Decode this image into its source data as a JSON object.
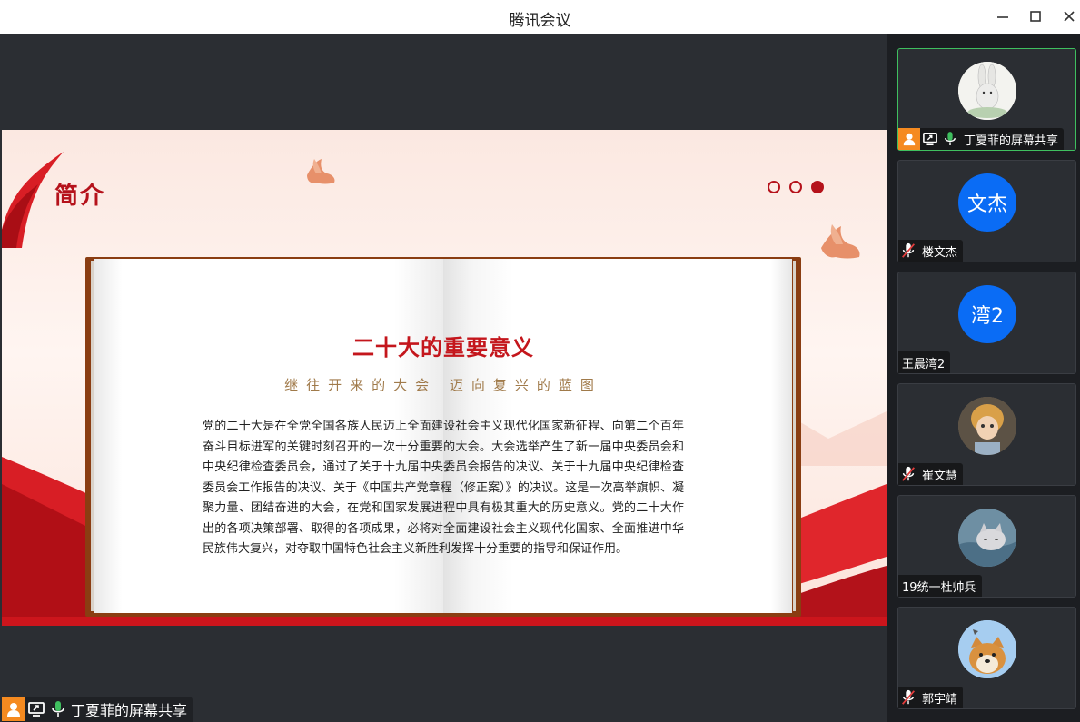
{
  "window": {
    "title": "腾讯会议"
  },
  "slide": {
    "title": "简介",
    "heading": "二十大的重要意义",
    "subtitle": "继往开来的大会  迈向复兴的蓝图",
    "body": "党的二十大是在全党全国各族人民迈上全面建设社会主义现代化国家新征程、向第二个百年奋斗目标进军的关键时刻召开的一次十分重要的大会。大会选举产生了新一届中央委员会和中央纪律检查委员会，通过了关于十九届中央委员会报告的决议、关于十九届中央纪律检查委员会工作报告的决议、关于《中国共产党章程（修正案）》的决议。这是一次高举旗帜、凝聚力量、团结奋进的大会，在党和国家发展进程中具有极其重大的历史意义。党的二十大作出的各项决策部署、取得的各项成果，必将对全面建设社会主义现代化国家、全面推进中华民族伟大复兴，对夺取中国特色社会主义新胜利发挥十分重要的指导和保证作用。",
    "page_count": 3,
    "current_page": 3
  },
  "share_badge": {
    "label": "丁夏菲的屏幕共享"
  },
  "participants": [
    {
      "name": "丁夏菲的屏幕共享",
      "avatar_type": "image",
      "avatar_desc": "rabbit",
      "muted": false,
      "host": true,
      "sharing": true,
      "active": true
    },
    {
      "name": "楼文杰",
      "avatar_type": "text",
      "avatar_text": "文杰",
      "muted": true,
      "active": false
    },
    {
      "name": "王晨湾2",
      "avatar_type": "text",
      "avatar_text": "湾2",
      "muted": null,
      "active": false
    },
    {
      "name": "崔文慧",
      "avatar_type": "image",
      "avatar_desc": "doll",
      "muted": true,
      "active": false
    },
    {
      "name": "19统一杜帅兵",
      "avatar_type": "image",
      "avatar_desc": "cat",
      "muted": null,
      "active": false
    },
    {
      "name": "郭宇靖",
      "avatar_type": "image",
      "avatar_desc": "shiba-dog",
      "muted": true,
      "active": false
    }
  ],
  "colors": {
    "accent_red": "#b5121b",
    "avatar_blue": "#0a6cf5",
    "host_orange": "#f58a20",
    "mic_green": "#3fbf5f",
    "mute_red": "#e23c3c"
  }
}
